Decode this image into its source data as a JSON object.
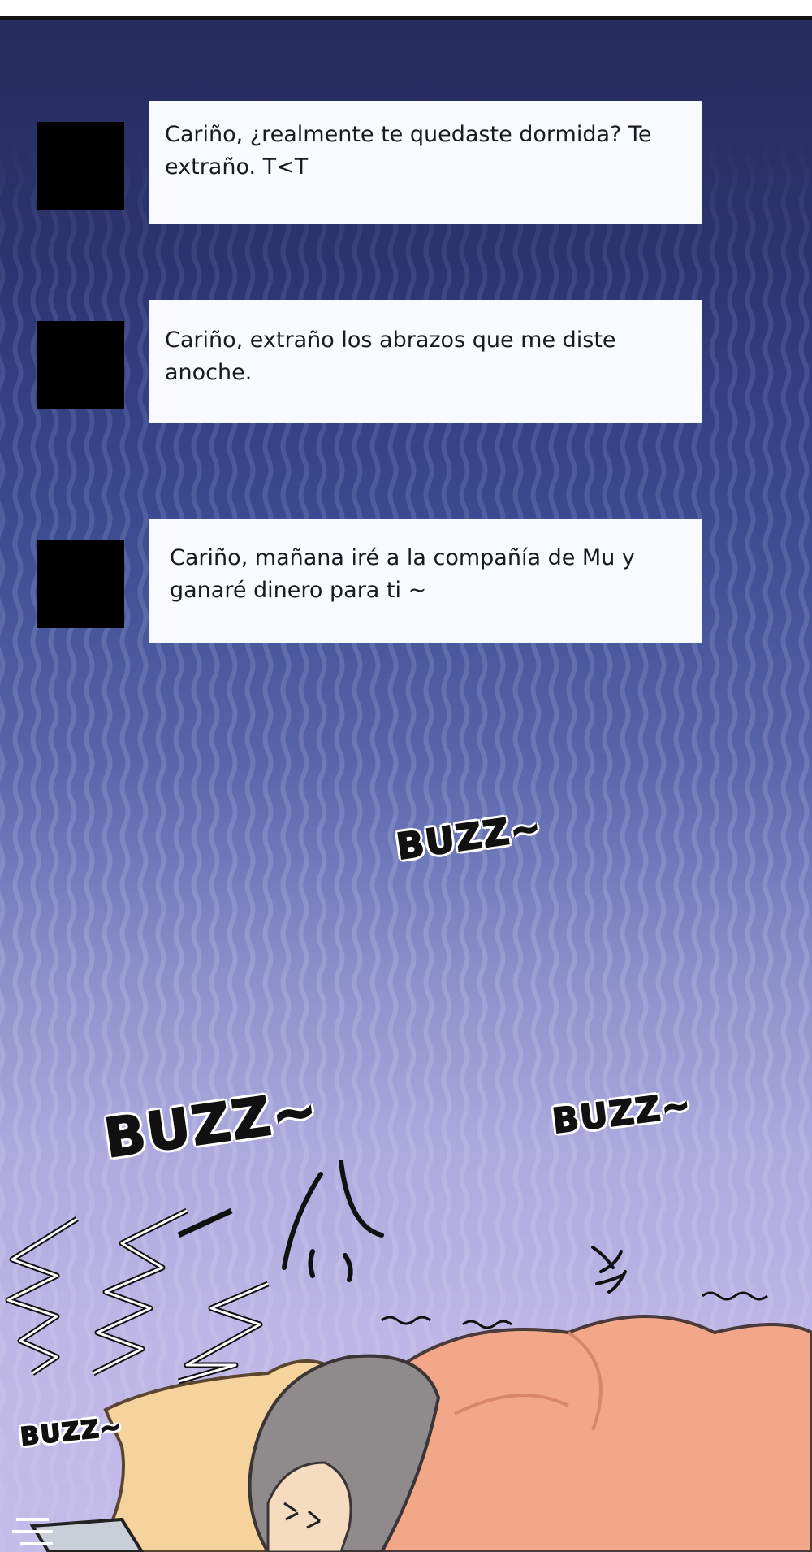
{
  "messages": [
    {
      "text": "Cariño, ¿realmente te quedaste dormida? Te extraño. T<T"
    },
    {
      "text": "Cariño, extraño los abrazos que me diste anoche."
    },
    {
      "text": "Cariño, mañana iré a la compañía de Mu y ganaré dinero para ti ~"
    }
  ],
  "sfx": [
    "BUZZ~",
    "BUZZ~",
    "BUZZ~",
    "BUZZ~"
  ],
  "colors": {
    "bubble": "#f7fbff",
    "avatar": "#000000",
    "blanket": "#f2a888",
    "pillow": "#f6d39c",
    "hair": "#8f8a8c"
  },
  "icons": {
    "avatar": "avatar-placeholder-square"
  }
}
